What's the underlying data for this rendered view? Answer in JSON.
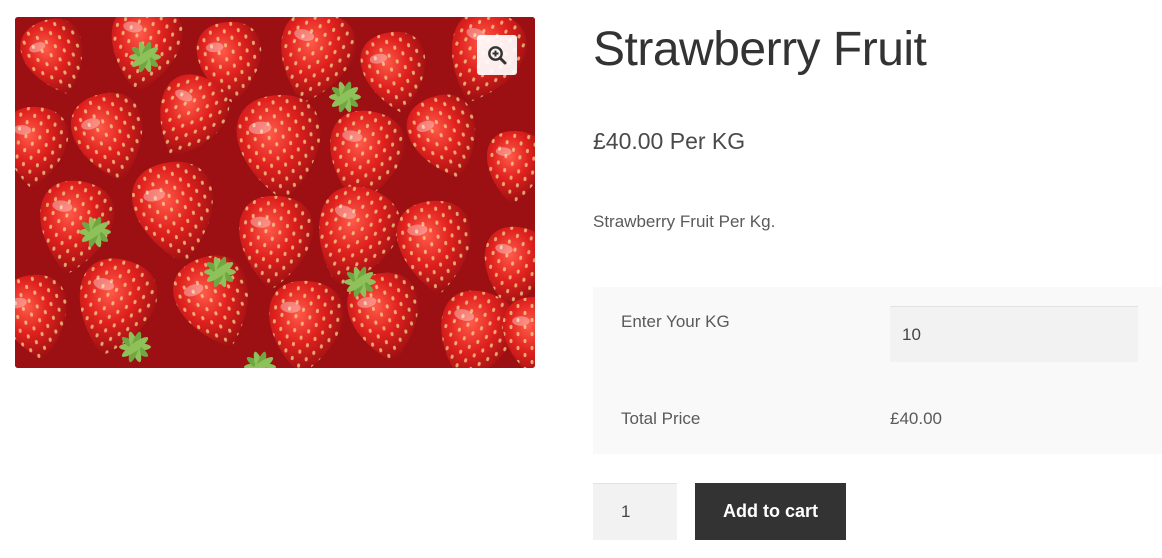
{
  "product": {
    "title": "Strawberry Fruit",
    "price": "£40.00 Per KG",
    "description": "Strawberry Fruit Per Kg.",
    "image_icon": "strawberries-photo",
    "zoom_icon": "zoom-in-icon"
  },
  "calculator": {
    "kg_label": "Enter Your KG",
    "kg_value": "10",
    "total_label": "Total Price",
    "total_value": "£40.00"
  },
  "cart": {
    "quantity": "1",
    "add_label": "Add to cart"
  },
  "colors": {
    "button_bg": "#333333",
    "input_bg": "#f2f2f2",
    "panel_bg": "#f9f9f9",
    "strawberry": "#d4191f"
  }
}
